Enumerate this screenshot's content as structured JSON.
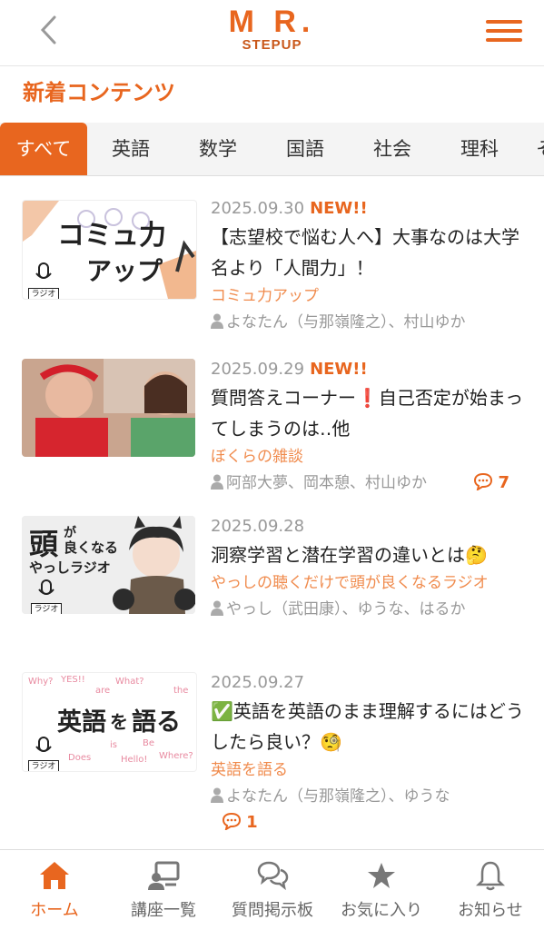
{
  "header": {
    "logo_main": "M R.",
    "logo_sub": "STEPUP"
  },
  "section_title": "新着コンテンツ",
  "tabs": [
    {
      "label": "すべて",
      "active": true
    },
    {
      "label": "英語"
    },
    {
      "label": "数学"
    },
    {
      "label": "国語"
    },
    {
      "label": "社会"
    },
    {
      "label": "理科"
    },
    {
      "label": "そ"
    }
  ],
  "items": [
    {
      "date": "2025.09.30",
      "new": "NEW!!",
      "title": "【志望校で悩む人へ】大事なのは大学名より「人間力」！",
      "category": "コミュ力アップ",
      "authors": "よなたん（与那嶺隆之）、村山ゆか",
      "thumb_text": [
        "コミュ力",
        "アップ"
      ],
      "thumb_badge": "ラジオ"
    },
    {
      "date": "2025.09.29",
      "new": "NEW!!",
      "title": "質問答えコーナー❗自己否定が始まってしまうのは‥他",
      "category": "ぼくらの雑談",
      "authors": "阿部大夢、岡本憩、村山ゆか",
      "comments": "7"
    },
    {
      "date": "2025.09.28",
      "title": "洞察学習と潜在学習の違いとは🤔",
      "category": "やっしの聴くだけで頭が良くなるラジオ",
      "authors": "やっし（武田康）、ゆうな、はるか",
      "thumb_text": [
        "頭",
        "が",
        "良くなる",
        "やっしラジオ"
      ],
      "thumb_badge": "ラジオ"
    },
    {
      "date": "2025.09.27",
      "title": "✅英語を英語のまま理解するにはどうしたら良い？🧐",
      "category": "英語を語る",
      "authors": "よなたん（与那嶺隆之）、ゆうな",
      "comments": "1",
      "thumb_text": [
        "英語",
        "を",
        "語る"
      ],
      "thumb_badge": "ラジオ",
      "thumb_words": [
        "Why?",
        "YES!!",
        "are",
        "What?",
        "the",
        "Does",
        "is",
        "Be",
        "Hello!",
        "Where?"
      ]
    }
  ],
  "bottom_nav": [
    {
      "label": "ホーム",
      "icon": "home-icon",
      "active": true
    },
    {
      "label": "講座一覧",
      "icon": "lecture-list-icon"
    },
    {
      "label": "質問掲示板",
      "icon": "question-board-icon"
    },
    {
      "label": "お気に入り",
      "icon": "star-icon"
    },
    {
      "label": "お知らせ",
      "icon": "bell-icon"
    }
  ],
  "colors": {
    "accent": "#e8661f",
    "category": "#f08b4d"
  }
}
